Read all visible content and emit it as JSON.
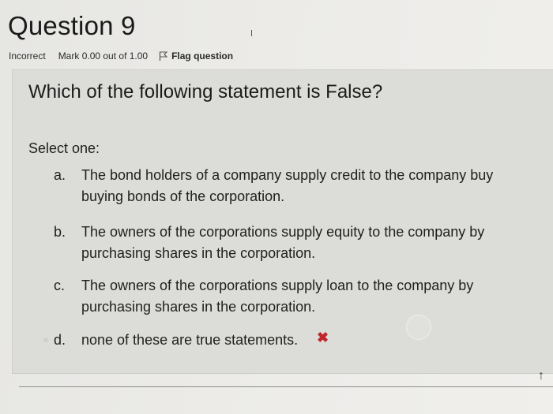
{
  "question": {
    "title": "Question 9",
    "status": "Incorrect",
    "mark": "Mark 0.00 out of 1.00",
    "flag_label": "Flag question",
    "text": "Which of the following statement is False?",
    "prompt": "Select one:"
  },
  "options": [
    {
      "letter": "a.",
      "text": "The bond holders of a company supply credit to the company buy buying bonds of the corporation."
    },
    {
      "letter": "b.",
      "text": "The owners of the corporations supply equity to the company by purchasing shares in the corporation."
    },
    {
      "letter": "c.",
      "text": "The owners of the corporations supply loan to the company by purchasing shares in the corporation."
    },
    {
      "letter": "d.",
      "text": "none of these are true statements."
    }
  ],
  "icons": {
    "flag": "flag-outline-icon",
    "incorrect": "red-cross-icon",
    "scroll_top": "arrow-up-icon"
  },
  "colors": {
    "incorrect": "#c0262b",
    "panel": "#dcdcd8",
    "page": "#ecebe8"
  },
  "selected_option": "d."
}
